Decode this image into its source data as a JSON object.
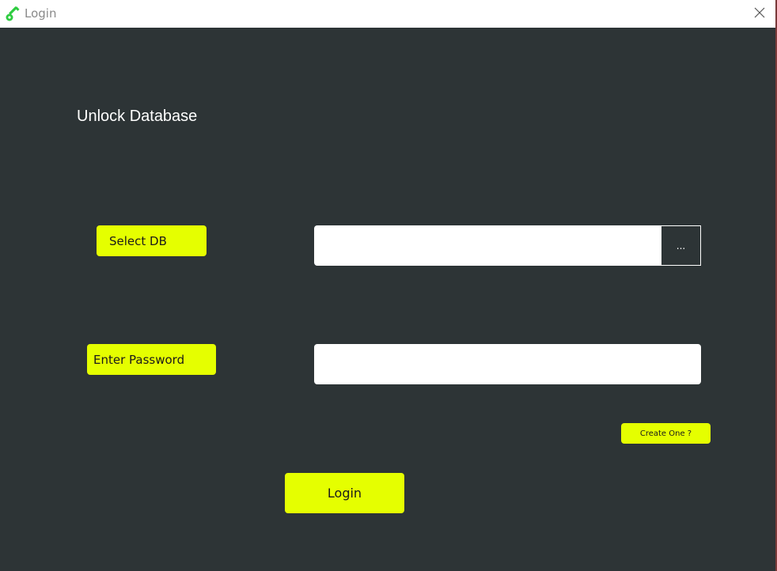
{
  "window": {
    "title": "Login",
    "title_icon": "key-icon",
    "close_icon": "close-icon"
  },
  "main": {
    "heading": "Unlock Database",
    "select_db_label": "Select DB",
    "db_path_value": "",
    "browse_label": "...",
    "password_label": "Enter Password",
    "password_value": "",
    "create_label": "Create One ?",
    "login_label": "Login"
  },
  "colors": {
    "background": "#2d3436",
    "accent": "#e5ff00",
    "key_icon": "#2ecc40"
  }
}
